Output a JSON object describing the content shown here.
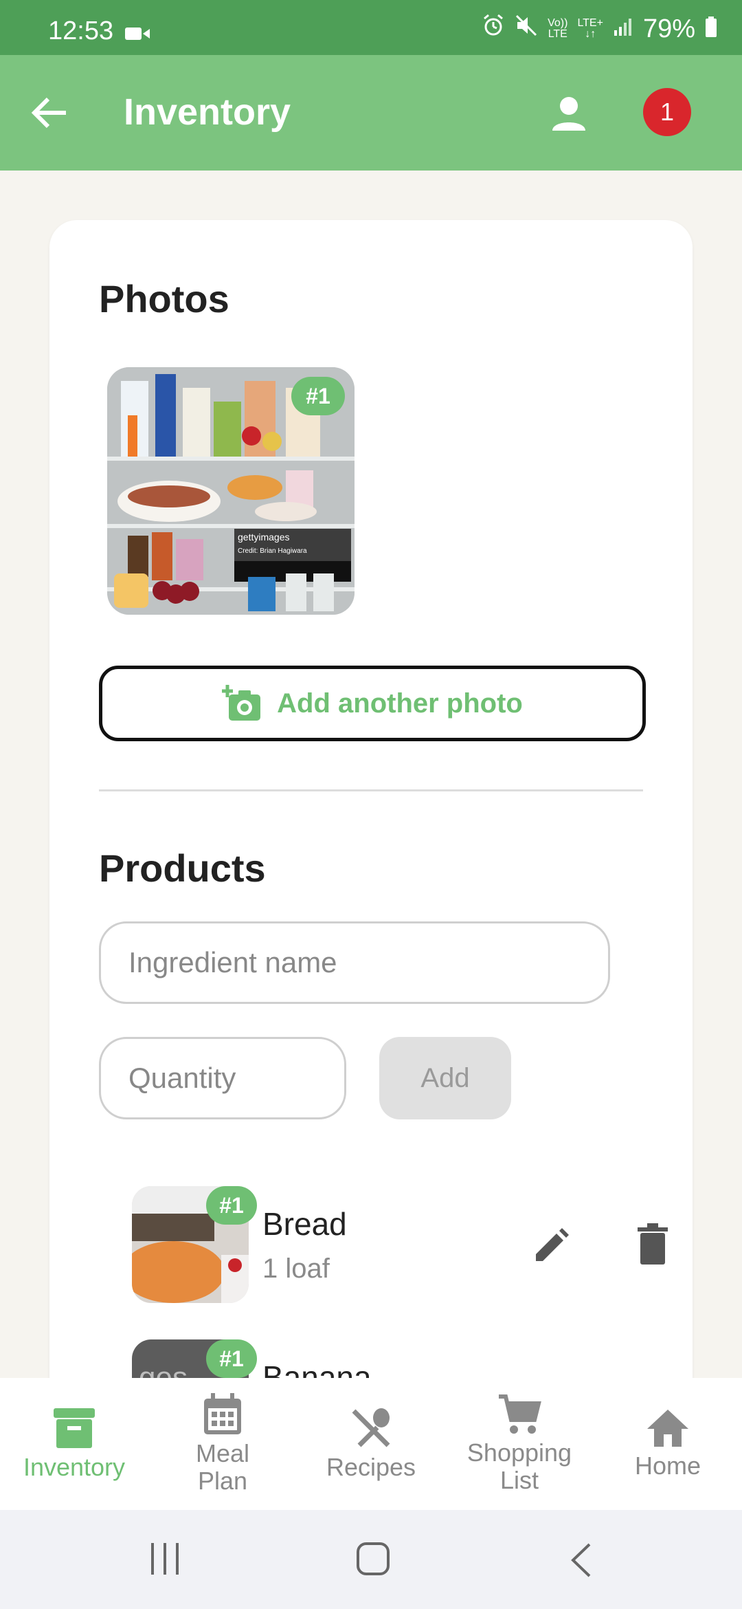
{
  "status_bar": {
    "time": "12:53",
    "volte_top": "Vo))",
    "volte_bottom": "LTE",
    "lte_top": "LTE+",
    "lte_bottom": "↓↑",
    "battery": "79%"
  },
  "app_bar": {
    "title": "Inventory",
    "notification_count": "1"
  },
  "photos": {
    "heading": "Photos",
    "items": [
      {
        "tag": "#1",
        "watermark": "gettyimages",
        "credit": "Credit: Brian Hagiwara"
      }
    ],
    "add_label": "Add another photo"
  },
  "products": {
    "heading": "Products",
    "ingredient_placeholder": "Ingredient name",
    "quantity_placeholder": "Quantity",
    "add_label": "Add",
    "items": [
      {
        "name": "Bread",
        "quantity": "1 loaf",
        "tag": "#1"
      },
      {
        "name": "Banana",
        "tag": "#1",
        "thumb_text": "ges"
      }
    ]
  },
  "bottom_nav": {
    "items": [
      {
        "label": "Inventory",
        "icon": "archive-icon",
        "active": true
      },
      {
        "label_line1": "Meal",
        "label_line2": "Plan",
        "icon": "calendar-icon"
      },
      {
        "label": "Recipes",
        "icon": "utensils-icon"
      },
      {
        "label_line1": "Shopping",
        "label_line2": "List",
        "icon": "cart-icon"
      },
      {
        "label": "Home",
        "icon": "home-icon"
      }
    ]
  },
  "colors": {
    "status_bar": "#4e9f57",
    "app_bar": "#7cc47f",
    "accent": "#6fbf73",
    "badge": "#d9262c",
    "background": "#f6f4ef"
  }
}
